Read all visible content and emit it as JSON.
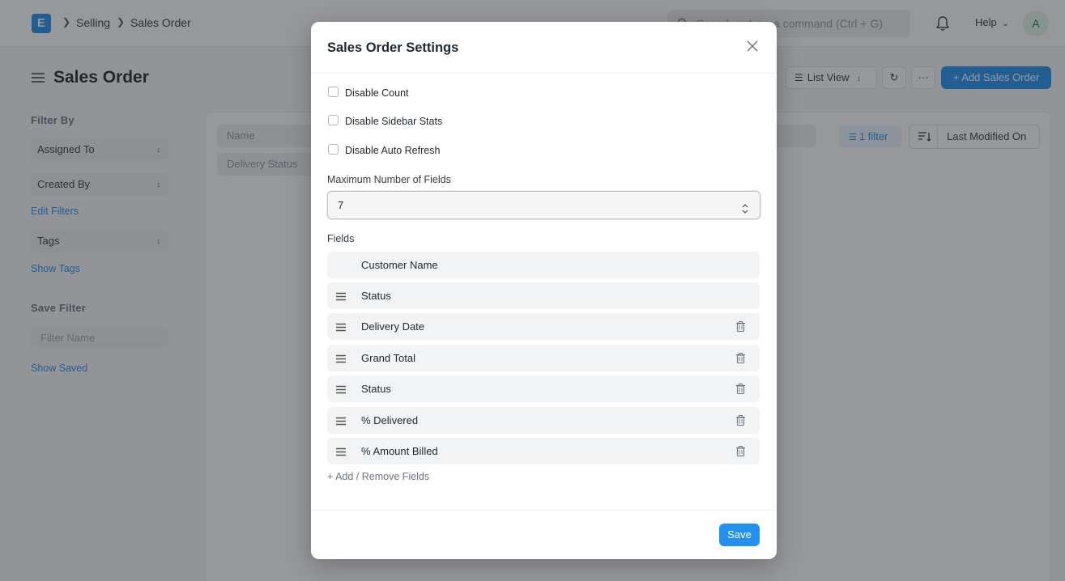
{
  "navbar": {
    "logo_letter": "E",
    "breadcrumbs": [
      "Selling",
      "Sales Order"
    ],
    "search_placeholder": "Search or type a command (Ctrl + G)",
    "help_label": "Help",
    "avatar_initial": "A"
  },
  "page": {
    "title": "Sales Order",
    "view_label": "List View",
    "add_label": "+ Add Sales Order"
  },
  "sidebar": {
    "filter_by_label": "Filter By",
    "assigned_to": "Assigned To",
    "created_by": "Created By",
    "edit_filters": "Edit Filters",
    "tags": "Tags",
    "show_tags": "Show Tags",
    "save_filter_label": "Save Filter",
    "filter_name_placeholder": "Filter Name",
    "show_saved": "Show Saved"
  },
  "list": {
    "name_placeholder": "Name",
    "delivery_status_placeholder": "Delivery Status",
    "filter_label": "1 filter",
    "sort_label": "Last Modified On"
  },
  "modal": {
    "title": "Sales Order Settings",
    "checkboxes": [
      {
        "label": "Disable Count",
        "checked": false
      },
      {
        "label": "Disable Sidebar Stats",
        "checked": false
      },
      {
        "label": "Disable Auto Refresh",
        "checked": false
      }
    ],
    "max_fields_label": "Maximum Number of Fields",
    "max_fields_value": "7",
    "fields_label": "Fields",
    "fields": [
      {
        "name": "Customer Name",
        "fixed": true
      },
      {
        "name": "Status",
        "fixed": true
      },
      {
        "name": "Delivery Date",
        "fixed": false
      },
      {
        "name": "Grand Total",
        "fixed": false
      },
      {
        "name": "Status",
        "fixed": false
      },
      {
        "name": "% Delivered",
        "fixed": false
      },
      {
        "name": "% Amount Billed",
        "fixed": false
      }
    ],
    "add_remove_label": "+ Add / Remove Fields",
    "save_label": "Save"
  },
  "colors": {
    "primary": "#2490ef",
    "overlay": "rgba(35,40,46,0.48)"
  }
}
